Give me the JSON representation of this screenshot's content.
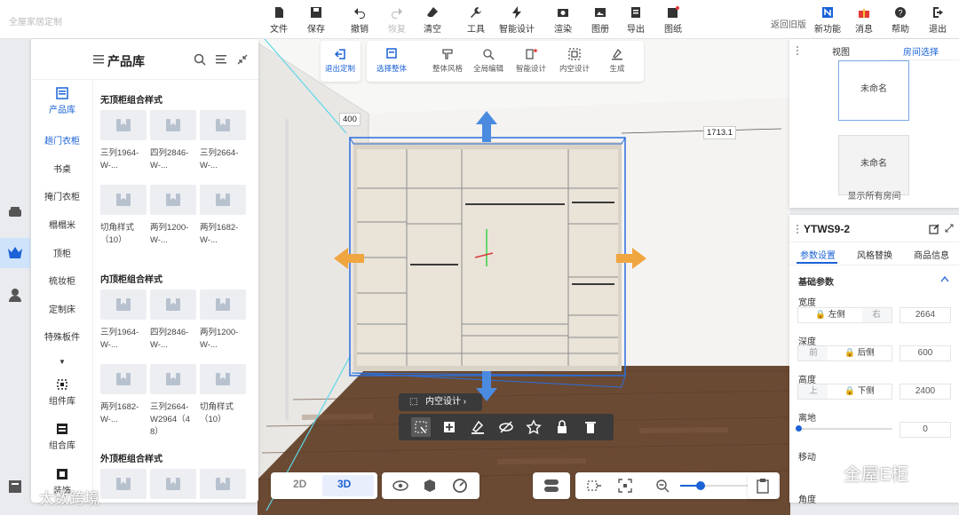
{
  "brand": "全屋家居定制",
  "toolbar": {
    "file": "文件",
    "save": "保存",
    "undo": "撤销",
    "redo": "恢复",
    "clear": "清空",
    "tools": "工具",
    "smart_design": "智能设计",
    "render": "渲染",
    "drawing": "图册",
    "export": "导出",
    "paper": "图纸",
    "return_old": "返回旧版",
    "new_feature": "新功能",
    "message": "消息",
    "help": "帮助",
    "exit": "退出"
  },
  "product_panel": {
    "title": "产品库",
    "categories": [
      "产品库",
      "趟门衣柜",
      "书桌",
      "掩门衣柜",
      "榻榻米",
      "顶柜",
      "梳妆柜",
      "定制床",
      "特殊板件",
      "组件库",
      "组合库",
      "装饰"
    ],
    "sections": [
      {
        "title": "无顶柜组合样式",
        "items": [
          "三列1964-W-...",
          "四列2846-W-...",
          "三列2664-W-...",
          "切角样式（10）",
          "两列1200-W-...",
          "两列1682-W-..."
        ]
      },
      {
        "title": "内顶柜组合样式",
        "items": [
          "三列1964-W-...",
          "四列2846-W-...",
          "两列1200-W-...",
          "两列1682-W-...",
          "三列2664-W2964（48）",
          "切角样式（10）"
        ]
      },
      {
        "title": "外顶柜组合样式",
        "items": [
          "",
          "",
          ""
        ]
      }
    ]
  },
  "mode_bar": {
    "exit_custom": "退出定制",
    "select_whole": "选择整体",
    "whole_style": "整体风格",
    "global_edit": "全局编辑",
    "smart_design": "智能设计",
    "inner_design": "内空设计",
    "generate": "生成"
  },
  "room_panel": {
    "tabs": [
      "视图",
      "房间选择"
    ],
    "rooms": [
      "未命名",
      "未命名"
    ],
    "show_all": "显示所有房间"
  },
  "props": {
    "title": "YTWS9-2",
    "tabs": [
      "参数设置",
      "风格替换",
      "商品信息"
    ],
    "section": "基础参数",
    "width": {
      "label": "宽度",
      "opt_a": "左侧",
      "opt_b": "右",
      "value": "2664"
    },
    "depth": {
      "label": "深度",
      "opt_a": "后侧",
      "opt_b": "前",
      "value": "600"
    },
    "height": {
      "label": "高度",
      "opt_a": "下侧",
      "opt_b": "上",
      "value": "2400"
    },
    "offset": {
      "label": "离地",
      "value": "0"
    },
    "move": {
      "label": "移动"
    },
    "angle": {
      "label": "角度"
    }
  },
  "dimensions": {
    "height_label": "400",
    "width_label": "1713.1"
  },
  "context_menu": {
    "inner_design": "内空设计"
  },
  "view_bar": {
    "d2": "2D",
    "d3": "3D"
  },
  "watermarks": {
    "left": "大数跨境",
    "right": "全屋E柜"
  },
  "colors": {
    "accent": "#1a62d6",
    "floor": "#6b4a33",
    "cabinet": "#e6dfd4",
    "selection": "#2b6fdd",
    "arrow_blue": "#4a8be0",
    "arrow_orange": "#f0a640"
  }
}
